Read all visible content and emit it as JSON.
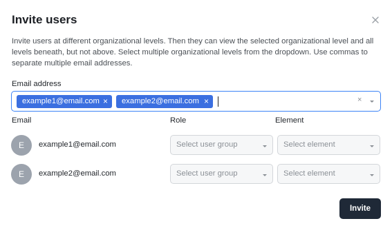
{
  "dialog": {
    "title": "Invite users",
    "close_icon": "close-icon",
    "description": "Invite users at different organizational levels. Then they can view the selected organizational level and all levels beneath, but not above. Select multiple organizational levels from the dropdown. Use commas to separate multiple email addresses."
  },
  "email_field": {
    "label": "Email address",
    "chips": [
      {
        "label": "example1@email.com",
        "remove": "×"
      },
      {
        "label": "example2@email.com",
        "remove": "×"
      }
    ],
    "clear_label": "×",
    "value": ""
  },
  "table": {
    "headers": {
      "email": "Email",
      "role": "Role",
      "element": "Element"
    },
    "rows": [
      {
        "avatar": "E",
        "email": "example1@email.com",
        "role_placeholder": "Select user group",
        "element_placeholder": "Select element"
      },
      {
        "avatar": "E",
        "email": "example2@email.com",
        "role_placeholder": "Select user group",
        "element_placeholder": "Select element"
      }
    ]
  },
  "footer": {
    "invite_label": "Invite"
  },
  "colors": {
    "accent": "#3b82f6",
    "chip": "#3b6fe0",
    "primary_button": "#1f2937",
    "avatar": "#9ca3ad"
  }
}
